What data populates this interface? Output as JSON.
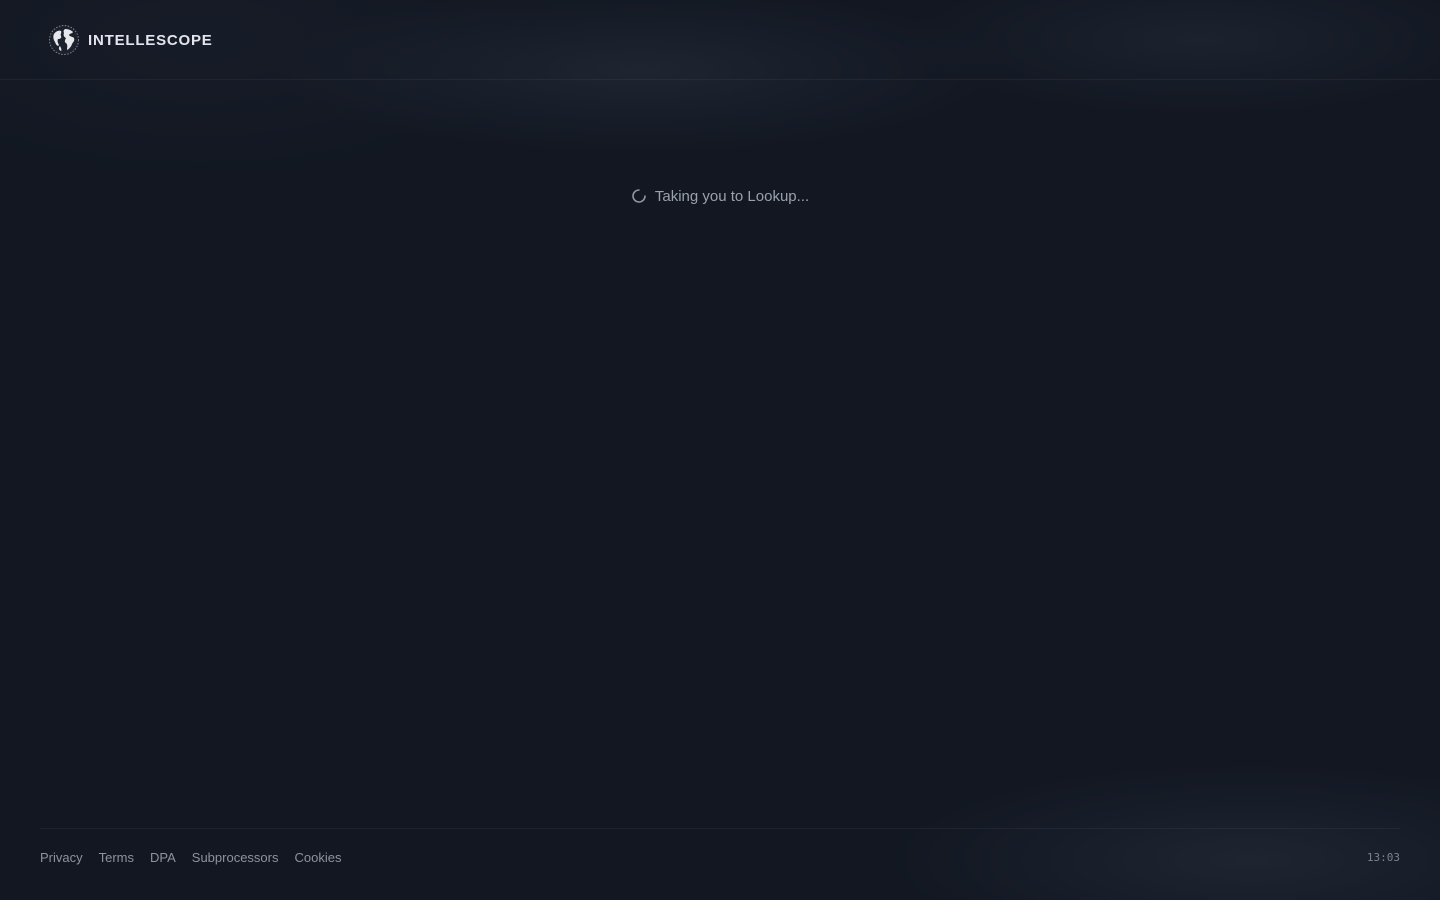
{
  "header": {
    "brand_name": "INTELLESCOPE",
    "logo_icon": "globe-icon"
  },
  "main": {
    "loading_text": "Taking you to Lookup...",
    "spinner_icon": "spinner-icon"
  },
  "footer": {
    "links": [
      "Privacy",
      "Terms",
      "DPA",
      "Subprocessors",
      "Cookies"
    ],
    "clock": "13:03"
  },
  "colors": {
    "background": "#121722",
    "brand_text": "#e3e6ec",
    "muted_text": "#8d939e"
  }
}
